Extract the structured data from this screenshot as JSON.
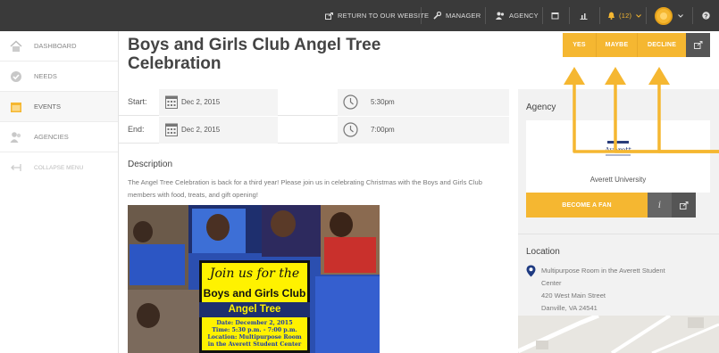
{
  "topbar": {
    "return_label": "RETURN TO OUR WEBSITE",
    "manager_label": "MANAGER",
    "agency_label": "AGENCY",
    "alerts_label": "(12)"
  },
  "sidebar": {
    "items": [
      {
        "label": "DASHBOARD"
      },
      {
        "label": "NEEDS"
      },
      {
        "label": "EVENTS"
      },
      {
        "label": "AGENCIES"
      }
    ],
    "collapse_label": "COLLAPSE MENU"
  },
  "event": {
    "title": "Boys and Girls Club Angel Tree Celebration",
    "start_label": "Start:",
    "start_date": "Dec 2, 2015",
    "start_time": "5:30pm",
    "end_label": "End:",
    "end_date": "Dec 2, 2015",
    "end_time": "7:00pm",
    "description_heading": "Description",
    "description": "The Angel Tree Celebration is back for a third year! Please join us in celebrating Christmas with the Boys and Girls Club members with food, treats, and gift opening!"
  },
  "rsvp": {
    "yes": "YES",
    "maybe": "MAYBE",
    "decline": "DECLINE"
  },
  "poster": {
    "join": "Join us for the",
    "line1": "Boys and Girls Club",
    "line2": "Angel Tree Celebration",
    "date": "Date: December 2, 2015",
    "time": "Time: 5:30 p.m. - 7:00 p.m.",
    "location": "Location: Multipurpose Room",
    "location2": "in the Averett Student Center"
  },
  "agency": {
    "heading": "Agency",
    "logo_text": "Averett",
    "name": "Averett University",
    "fan_button": "BECOME A FAN",
    "info_glyph": "i"
  },
  "location": {
    "heading": "Location",
    "line1": "Multipurpose Room in the Averett Student",
    "line2": "Center",
    "line3": "420 West Main Street",
    "line4": "Danville, VA 24541"
  },
  "colors": {
    "accent": "#f5b731",
    "topbar": "#3a3a3a",
    "arrow": "#f5b731"
  }
}
